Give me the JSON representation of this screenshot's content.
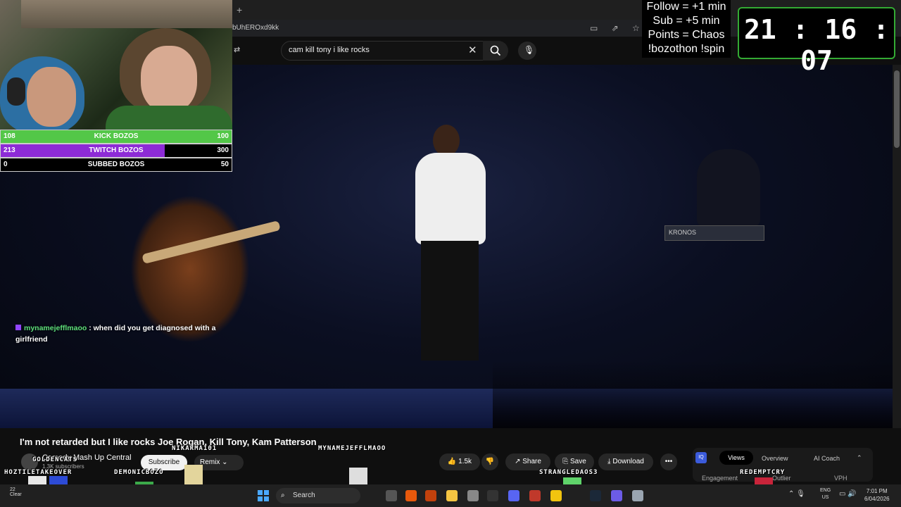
{
  "browser": {
    "new_tab": "+",
    "url": "bUhEROxd9kk"
  },
  "youtube": {
    "search_query": "cam kill tony i like rocks",
    "video_title": "I'm not retarded but I like rocks Joe Rogan, Kill Tony, Kam Patterson",
    "channel": "Comedy Mash Up Central",
    "subscribers": "1.3K subscribers",
    "subscribe_label": "Subscribe",
    "remix_label": "Remix",
    "likes": "1.5k",
    "share_label": "Share",
    "save_label": "Save",
    "download_label": "Download",
    "more_label": "•••",
    "keyboard_label": "KRONOS"
  },
  "ai_panel": {
    "logo": "IQ",
    "views_tab": "Views",
    "overview_tab": "Overview",
    "coach_tab": "AI Coach",
    "engagement": "Engagement",
    "outlier": "Outlier",
    "vph": "VPH"
  },
  "goals": [
    {
      "current": "108",
      "label": "KICK BOZOS",
      "target": "100",
      "fraction": 1.0,
      "color": "#53c748"
    },
    {
      "current": "213",
      "label": "TWITCH BOZOS",
      "target": "300",
      "fraction": 0.71,
      "color": "#8d2bd6"
    },
    {
      "current": "0",
      "label": "SUBBED BOZOS",
      "target": "50",
      "fraction": 0.0,
      "color": "#53c748"
    }
  ],
  "chat": {
    "username": "mynamejefflmaoo",
    "message": ": when did you get diagnosed with a girlfriend"
  },
  "stream_overlay": {
    "rules": [
      "Follow = +1 min",
      "Sub = +5 min",
      "Points = Chaos",
      "!bozothon !spin"
    ],
    "timer": "21 : 16 : 07"
  },
  "viewer_sprites": {
    "names": [
      "GOLDENCATS",
      "HOZTILETAKEOVER",
      "DEMONICBOZO",
      "NIKARMA101",
      "MYNAMEJEFFLMAOO",
      "STRANGLEDAOS3",
      "REDEMPTCRY"
    ]
  },
  "taskbar": {
    "search_label": "Search",
    "weather_temp": "22",
    "weather_desc": "Clear",
    "lang_top": "ENG",
    "lang_bottom": "US",
    "time": "7:01 PM",
    "date": "6/04/2026"
  }
}
